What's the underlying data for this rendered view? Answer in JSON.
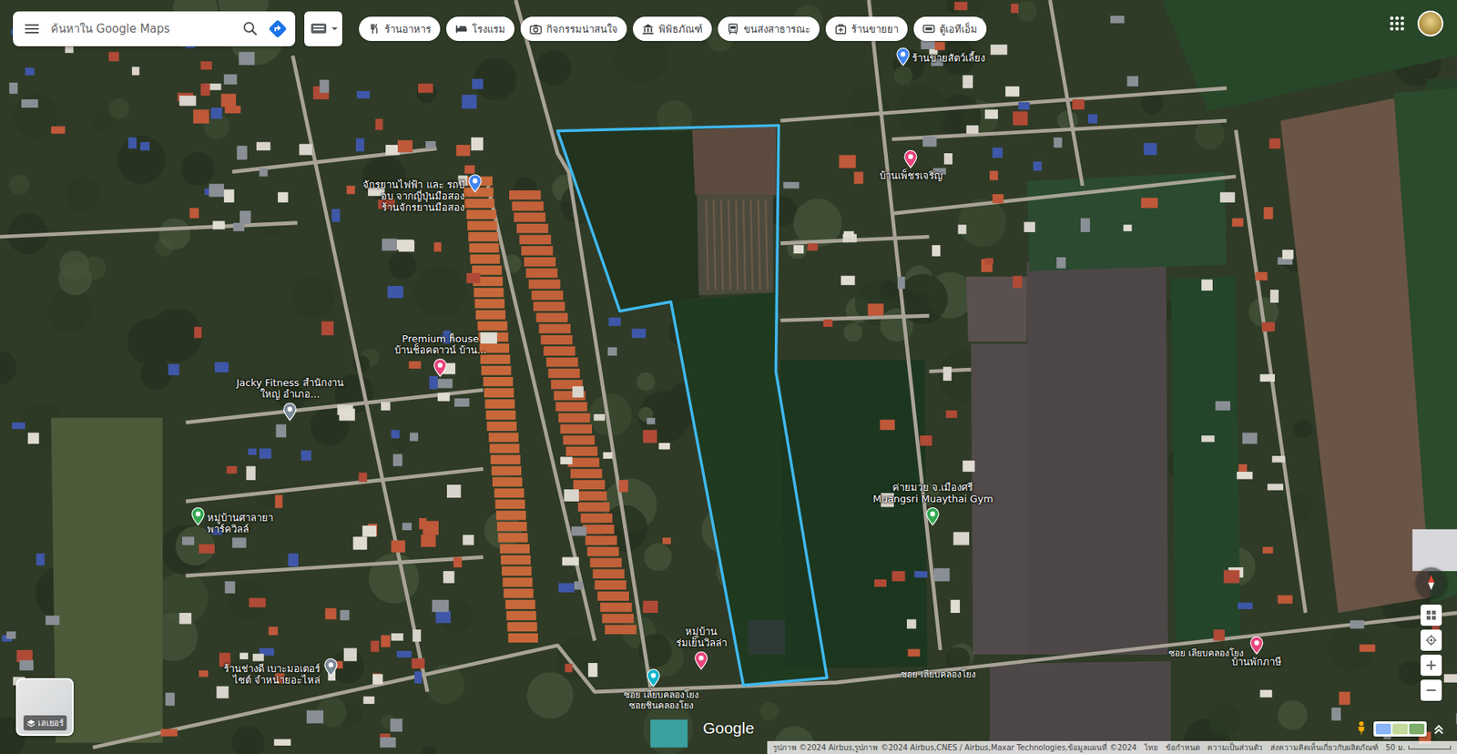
{
  "search": {
    "placeholder": "ค้นหาใน Google Maps"
  },
  "chips": [
    {
      "label": "ร้านอาหาร"
    },
    {
      "label": "โรงแรม"
    },
    {
      "label": "กิจกรรมน่าสนใจ"
    },
    {
      "label": "พิพิธภัณฑ์"
    },
    {
      "label": "ขนส่งสาธารณะ"
    },
    {
      "label": "ร้านขายยา"
    },
    {
      "label": "ตู้เอทีเอ็ม"
    }
  ],
  "map": {
    "places": [
      {
        "lines": [
          "จักรยานไฟฟ้า และ รถป๊",
          "อบ จากญี่ปุ่นมือสอง",
          "ร้านจักรยานมือสอง"
        ],
        "color": "#4285f4"
      },
      {
        "lines": [
          "Premium house",
          "บ้านช็อคดาวน์ บ้าน..."
        ],
        "color": "#e8437a"
      },
      {
        "lines": [
          "Jacky Fitness สำนักงาน",
          "ใหญ่ อำเภอ..."
        ],
        "color": "#7b8a99"
      },
      {
        "lines": [
          "หมู่บ้านศาลายา",
          "พาร์ควิลล์"
        ],
        "color": "#34a853"
      },
      {
        "lines": [
          "ร้านช่างดี เบาะมอเตอร์",
          "ไซต์ จำหน่ายอะไหล่"
        ],
        "color": "#7b8a99"
      },
      {
        "lines": [
          "หมู่บ้าน",
          "ร่มเย็นวิลล่า"
        ],
        "color": "#e8437a"
      },
      {
        "lines": [
          "บ้านเพ็ชรเจริญ"
        ],
        "color": "#e8437a"
      },
      {
        "lines": [
          "ร้านขายสัตว์เลี้ยง"
        ],
        "color": "#4285f4"
      },
      {
        "lines": [
          "ค่ายมวย จ.เมืองศรี",
          "Muangsri Muaythai Gym"
        ],
        "color": "#34a853"
      },
      {
        "lines": [
          "บ้านพักภาษี"
        ],
        "color": "#e8437a"
      },
      {
        "lines": [],
        "color": "#12b5cb"
      }
    ],
    "road_labels": [
      "ซอย เลียบคลองโยง",
      "ซอยชินคลองโยง",
      "ซอย เลียบคลองโยง",
      "ซอย เลียบคลองโยง"
    ]
  },
  "layers_button": {
    "label": "เลเยอร์"
  },
  "logo": "Google",
  "attribution": {
    "imagery": "รูปภาพ ©2024 Airbus,รูปภาพ ©2024 Airbus,CNES / Airbus,Maxar Technologies,ข้อมูลแผนที่ ©2024",
    "links": [
      "ไทย",
      "ข้อกำหนด",
      "ความเป็นส่วนตัว",
      "ส่งความคิดเห็นเกี่ยวกับผลิตภัณฑ์"
    ],
    "scale": "50 ม."
  }
}
